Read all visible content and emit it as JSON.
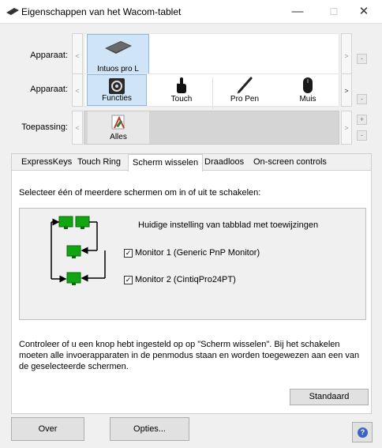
{
  "window": {
    "title": "Eigenschappen van het Wacom-tablet",
    "minimize": "—",
    "maximize": "☐",
    "close": "✕",
    "icon": "tablet-icon"
  },
  "device_row": {
    "label": "Apparaat:",
    "left_arrow": "<",
    "right_arrow": ">",
    "minus": "-",
    "tablet": {
      "label": "Intuos pro L"
    }
  },
  "tool_row": {
    "label": "Apparaat:",
    "left_arrow": "<",
    "right_arrow": ">",
    "minus": "-",
    "tools": [
      {
        "label": "Functies",
        "icon": "functions-icon"
      },
      {
        "label": "Touch",
        "icon": "touch-hand-icon"
      },
      {
        "label": "Pro Pen",
        "icon": "pen-icon"
      },
      {
        "label": "Muis",
        "icon": "mouse-icon"
      }
    ]
  },
  "app_row": {
    "label": "Toepassing:",
    "left_arrow": "<",
    "right_arrow": ">",
    "plus": "+",
    "minus": "-",
    "app": {
      "label": "Alles",
      "icon": "all-apps-icon"
    }
  },
  "tabs": [
    "ExpressKeys",
    "Touch Ring",
    "Scherm wisselen",
    "Draadloos",
    "On-screen controls"
  ],
  "panel": {
    "instruction": "Selecteer één of meerdere schermen om in of uit te schakelen:",
    "current_setting": "Huidige instelling van tabblad met toewijzingen",
    "monitors": [
      {
        "label": "Monitor 1 (Generic PnP Monitor)",
        "checked": true
      },
      {
        "label": "Monitor 2 (CintiqPro24PT)",
        "checked": true
      }
    ],
    "checkmark": "✓",
    "description": "Controleer of u een knop hebt ingesteld op op \"Scherm wisselen\". Bij het schakelen moeten alle invoerapparaten in de penmodus staan en worden toegewezen aan een van de geselecteerde schermen.",
    "default_button": "Standaard"
  },
  "footer": {
    "about": "Over",
    "options": "Opties...",
    "help": "?"
  },
  "colors": {
    "monitor_green": "#11a511",
    "selected_bg": "#cfe4f7",
    "help_blue": "#3b64c8"
  }
}
